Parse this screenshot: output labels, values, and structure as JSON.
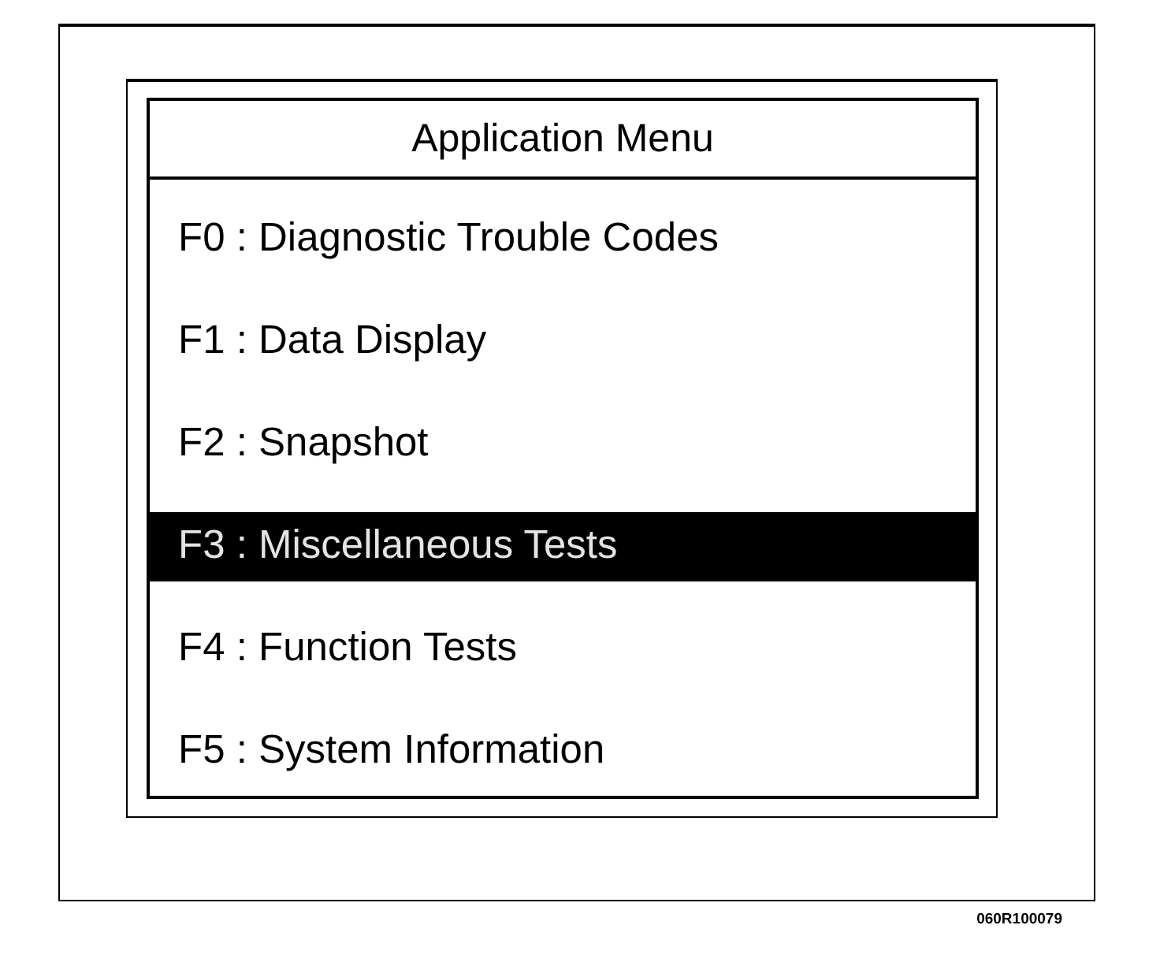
{
  "menu": {
    "title": "Application Menu",
    "items": [
      {
        "label": "F0 : Diagnostic Trouble Codes",
        "selected": false
      },
      {
        "label": "F1 : Data Display",
        "selected": false
      },
      {
        "label": "F2 : Snapshot",
        "selected": false
      },
      {
        "label": "F3 : Miscellaneous Tests",
        "selected": true
      },
      {
        "label": "F4 : Function Tests",
        "selected": false
      },
      {
        "label": "F5 : System Information",
        "selected": false
      }
    ]
  },
  "figure_code": "060R100079"
}
